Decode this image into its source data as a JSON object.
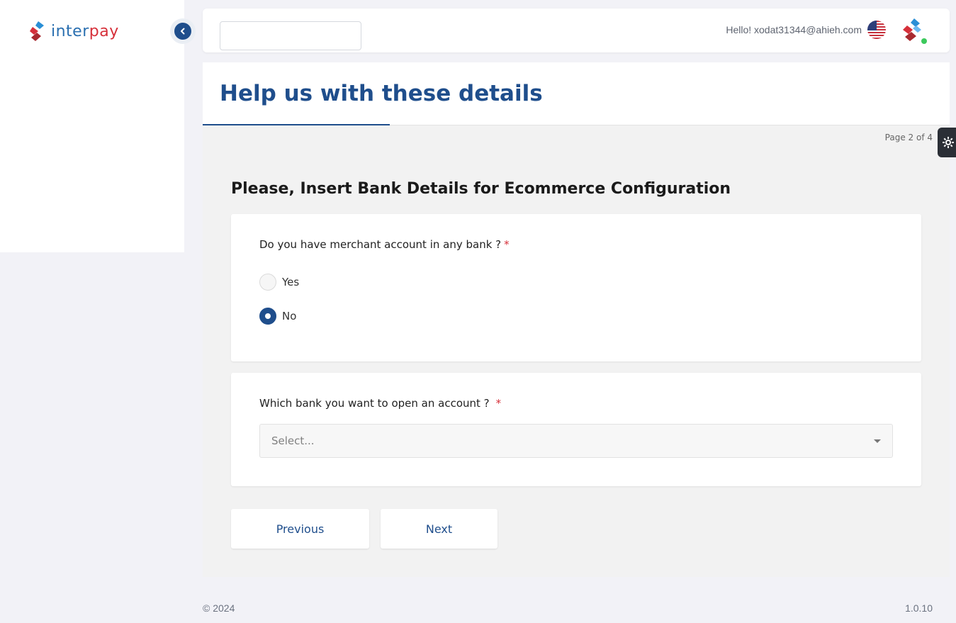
{
  "brand": {
    "logo_part1": "inter",
    "logo_part2": "pay",
    "primary": "#1f4e8c",
    "accent": "#d6303a",
    "online": "#3cc95c"
  },
  "header": {
    "greeting": "Hello! xodat31344@ahieh.com",
    "search_value": "",
    "flag_icon": "us-flag-icon",
    "avatar_icon": "interpay-avatar-icon"
  },
  "panel": {
    "title": "Help us with these details",
    "page_indicator": "Page 2 of 4",
    "progress": 0.25,
    "section_title": "Please, Insert Bank Details for Ecommerce Configuration"
  },
  "question1": {
    "label": "Do you have merchant account in any bank ?",
    "required_mark": "*",
    "options": [
      {
        "label": "Yes",
        "checked": false
      },
      {
        "label": "No",
        "checked": true
      }
    ]
  },
  "question2": {
    "label": "Which bank you want to open an account ?",
    "required_mark": "*",
    "placeholder": "Select..."
  },
  "buttons": {
    "previous": "Previous",
    "next": "Next"
  },
  "footer": {
    "copyright": "© 2024",
    "version": "1.0.10"
  }
}
